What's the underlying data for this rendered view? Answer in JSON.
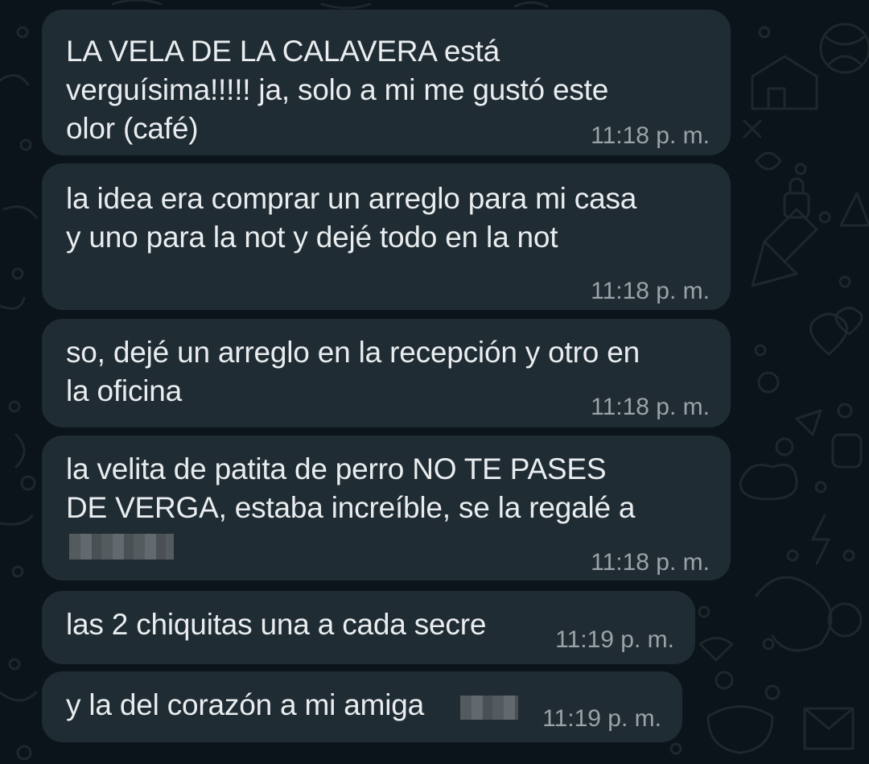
{
  "messages": [
    {
      "text": "LA VELA DE LA CALAVERA está\nverguísima!!!!! ja, solo a mi me gustó este\nolor (café)",
      "time": "11:18 p. m."
    },
    {
      "text": "la idea era comprar un arreglo para mi casa\ny uno para la not y dejé todo en la not",
      "time": "11:18 p. m."
    },
    {
      "text": "so, dejé un arreglo en la recepción y otro en\nla oficina",
      "time": "11:18 p. m."
    },
    {
      "text": "la velita de patita de perro NO TE PASES\nDE VERGA, estaba increíble, se la regalé a",
      "time": "11:18 p. m."
    },
    {
      "text": "las 2 chiquitas una a cada secre",
      "time": "11:19 p. m."
    },
    {
      "text": "y la del corazón a mi amiga",
      "time": "11:19 p. m."
    }
  ],
  "colors": {
    "background": "#0b141a",
    "bubble": "#202c33",
    "text": "#e9edef",
    "timestamp": "#9aa3a8"
  }
}
